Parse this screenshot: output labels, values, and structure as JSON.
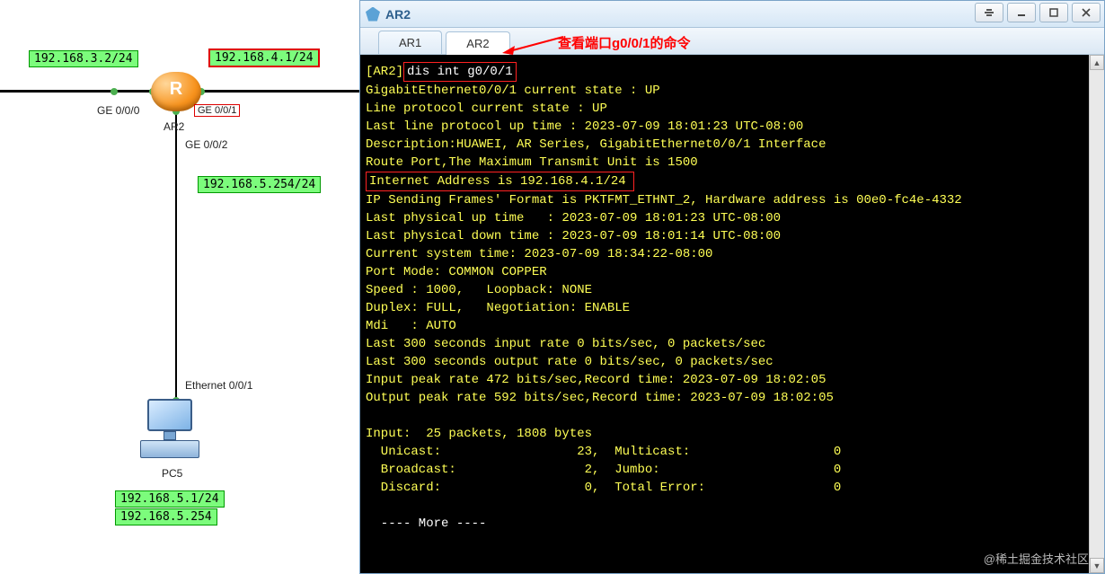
{
  "topology": {
    "ip_left": "192.168.3.2/24",
    "ip_right": "192.168.4.1/24",
    "ip_bottom": "192.168.5.254/24",
    "port_ge000": "GE 0/0/0",
    "port_ge001": "GE 0/0/1",
    "port_ge002": "GE 0/0/2",
    "router_name": "AR2",
    "pc_port": "Ethernet 0/0/1",
    "pc_name": "PC5",
    "pc_ip1": "192.168.5.1/24",
    "pc_ip2": "192.168.5.254"
  },
  "window": {
    "title": "AR2",
    "tabs": {
      "t1": "AR1",
      "t2": "AR2"
    },
    "annotation": "查看端口g0/0/1的命令"
  },
  "terminal": {
    "prompt_host": "[AR2]",
    "prompt_cmd": "dis int g0/0/1",
    "lines": {
      "l1": "GigabitEthernet0/0/1 current state : UP",
      "l2": "Line protocol current state : UP",
      "l3": "Last line protocol up time : 2023-07-09 18:01:23 UTC-08:00",
      "l4": "Description:HUAWEI, AR Series, GigabitEthernet0/0/1 Interface",
      "l5": "Route Port,The Maximum Transmit Unit is 1500",
      "l6": "Internet Address is 192.168.4.1/24",
      "l7": "IP Sending Frames' Format is PKTFMT_ETHNT_2, Hardware address is 00e0-fc4e-4332",
      "l8": "Last physical up time   : 2023-07-09 18:01:23 UTC-08:00",
      "l9": "Last physical down time : 2023-07-09 18:01:14 UTC-08:00",
      "l10": "Current system time: 2023-07-09 18:34:22-08:00",
      "l11": "Port Mode: COMMON COPPER",
      "l12": "Speed : 1000,   Loopback: NONE",
      "l13": "Duplex: FULL,   Negotiation: ENABLE",
      "l14": "Mdi   : AUTO",
      "l15": "Last 300 seconds input rate 0 bits/sec, 0 packets/sec",
      "l16": "Last 300 seconds output rate 0 bits/sec, 0 packets/sec",
      "l17": "Input peak rate 472 bits/sec,Record time: 2023-07-09 18:02:05",
      "l18": "Output peak rate 592 bits/sec,Record time: 2023-07-09 18:02:05",
      "blank": "",
      "l19": "Input:  25 packets, 1808 bytes",
      "l20": "  Unicast:                  23,  Multicast:                   0",
      "l21": "  Broadcast:                 2,  Jumbo:                       0",
      "l22": "  Discard:                   0,  Total Error:                 0",
      "more": "  ---- More ----"
    }
  },
  "watermark": "@稀土掘金技术社区"
}
